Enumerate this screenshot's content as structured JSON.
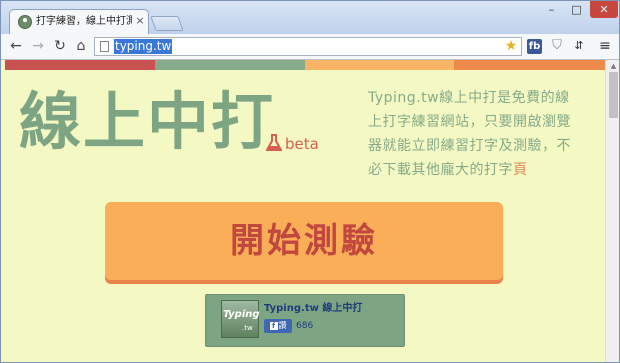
{
  "browser": {
    "tab_title": "打字練習，線上中打測驗",
    "tab_close": "×",
    "url": "typing.tw",
    "window_min": "–",
    "window_max": "□",
    "window_close": "✕",
    "nav_back": "←",
    "nav_forward": "→",
    "nav_reload": "↻",
    "nav_home": "⌂",
    "star_icon": "★",
    "ext_fb": "fb",
    "ext_shield": "⛉",
    "ext_translate": "⇵",
    "menu_icon": "≡"
  },
  "page": {
    "colorbar_colors": [
      "#c9514f",
      "#86ab8a",
      "#f9b466",
      "#ef8a4d"
    ],
    "title": "線上中打",
    "beta": "beta",
    "intro": "Typing.tw線上中打是免費的線上打字練習網站，只要開啟瀏覽器就能立即練習打字及測驗，不必下載其他龐大的打字",
    "intro_tail": "頁",
    "start_button": "開始測驗",
    "fb_box": {
      "logo_text": "Typing",
      "logo_sub": ".tw",
      "name": "Typing.tw 線上中打",
      "like_f": "f",
      "like_label": "讚",
      "like_count": "686"
    }
  },
  "colors": {
    "page_bg": "#f4f9c4",
    "title": "#7da584",
    "accent_orange": "#fbae58",
    "accent_red": "#c2473e"
  }
}
